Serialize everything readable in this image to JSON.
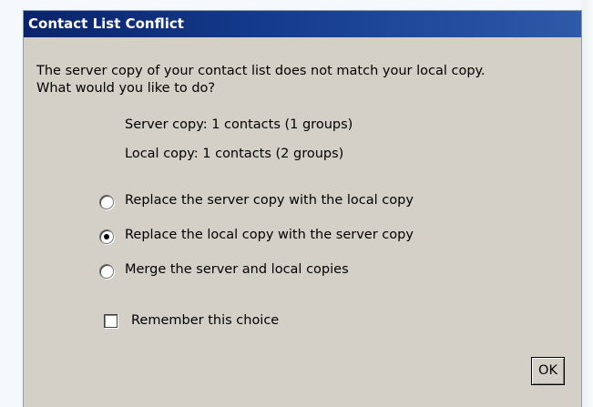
{
  "dialog": {
    "title": "Contact List Conflict",
    "message_line1": "The server copy of your contact list does not match your local copy.",
    "message_line2": "What would you like to do?",
    "server_copy": "Server copy: 1 contacts (1 groups)",
    "local_copy": "Local copy: 1 contacts (2 groups)",
    "options": [
      {
        "label": "Replace the server copy with the local copy",
        "checked": false
      },
      {
        "label": "Replace the local copy with the server copy",
        "checked": true
      },
      {
        "label": "Merge the server and local copies",
        "checked": false
      }
    ],
    "remember_label": "Remember this choice",
    "remember_checked": false,
    "ok_label": "OK"
  }
}
